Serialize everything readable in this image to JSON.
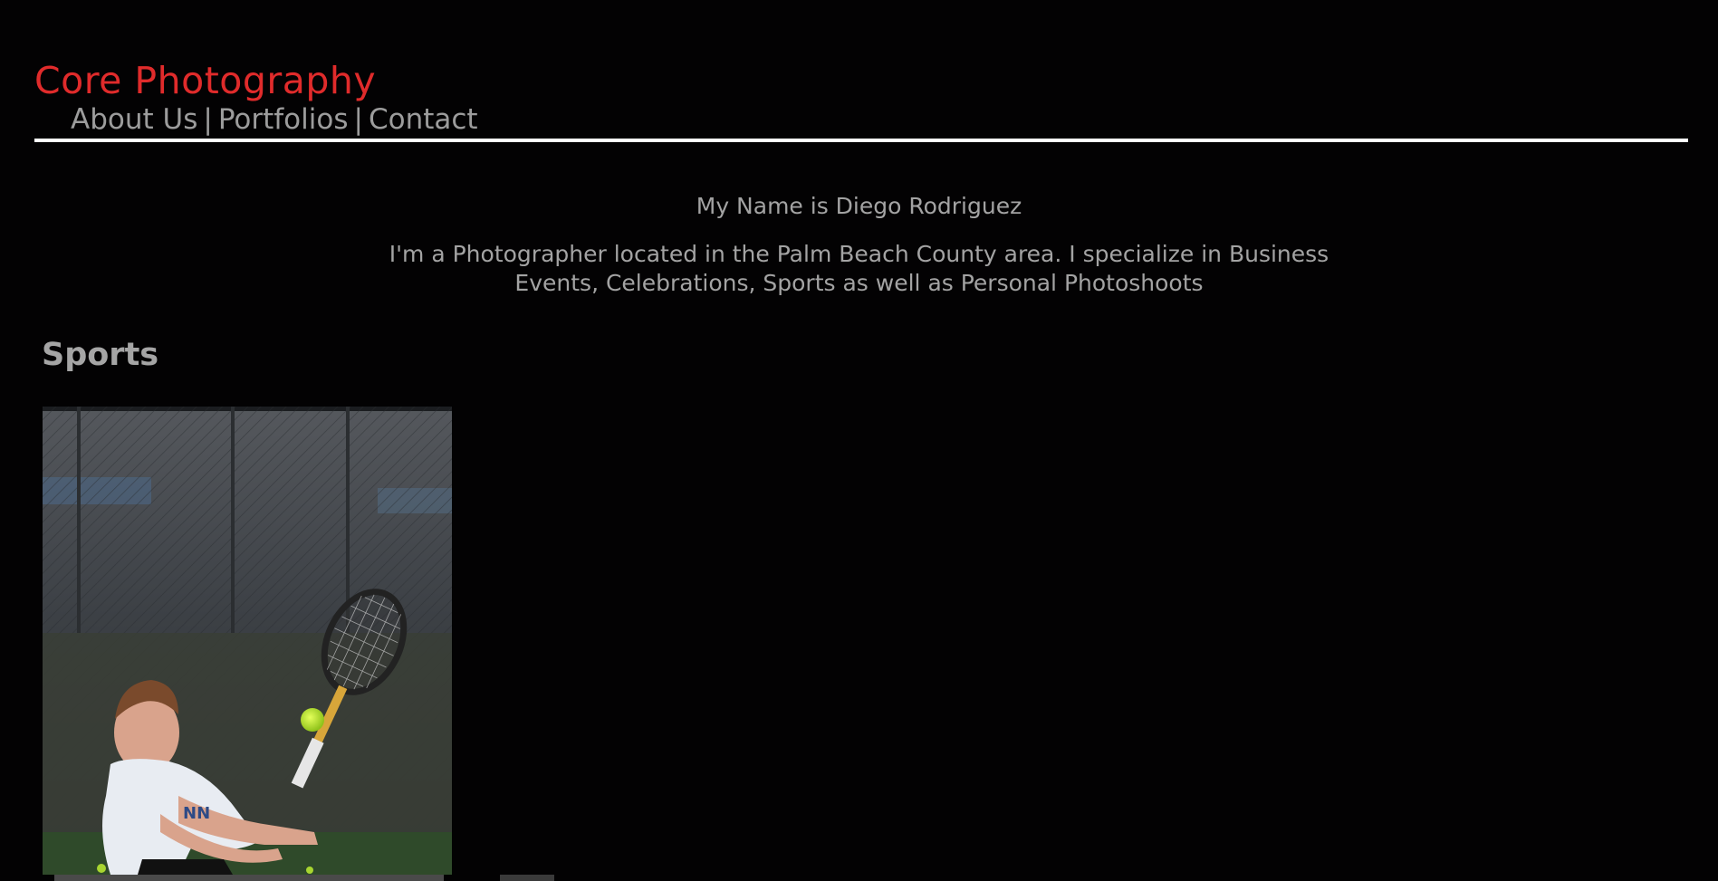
{
  "brand": {
    "title": "Core Photography",
    "color": "#e02b2b"
  },
  "nav": {
    "items": [
      {
        "label": "About Us"
      },
      {
        "label": "Portfolios"
      },
      {
        "label": "Contact"
      }
    ],
    "separator": "|"
  },
  "intro": {
    "heading": "My Name is Diego Rodriguez",
    "bio": "I'm a Photographer located in the Palm Beach County area. I specialize in Business Events, Celebrations, Sports as well as Personal Photoshoots"
  },
  "sections": [
    {
      "title": "Sports",
      "images": [
        {
          "subject": "tennis-player-backhand-photo"
        }
      ]
    }
  ]
}
